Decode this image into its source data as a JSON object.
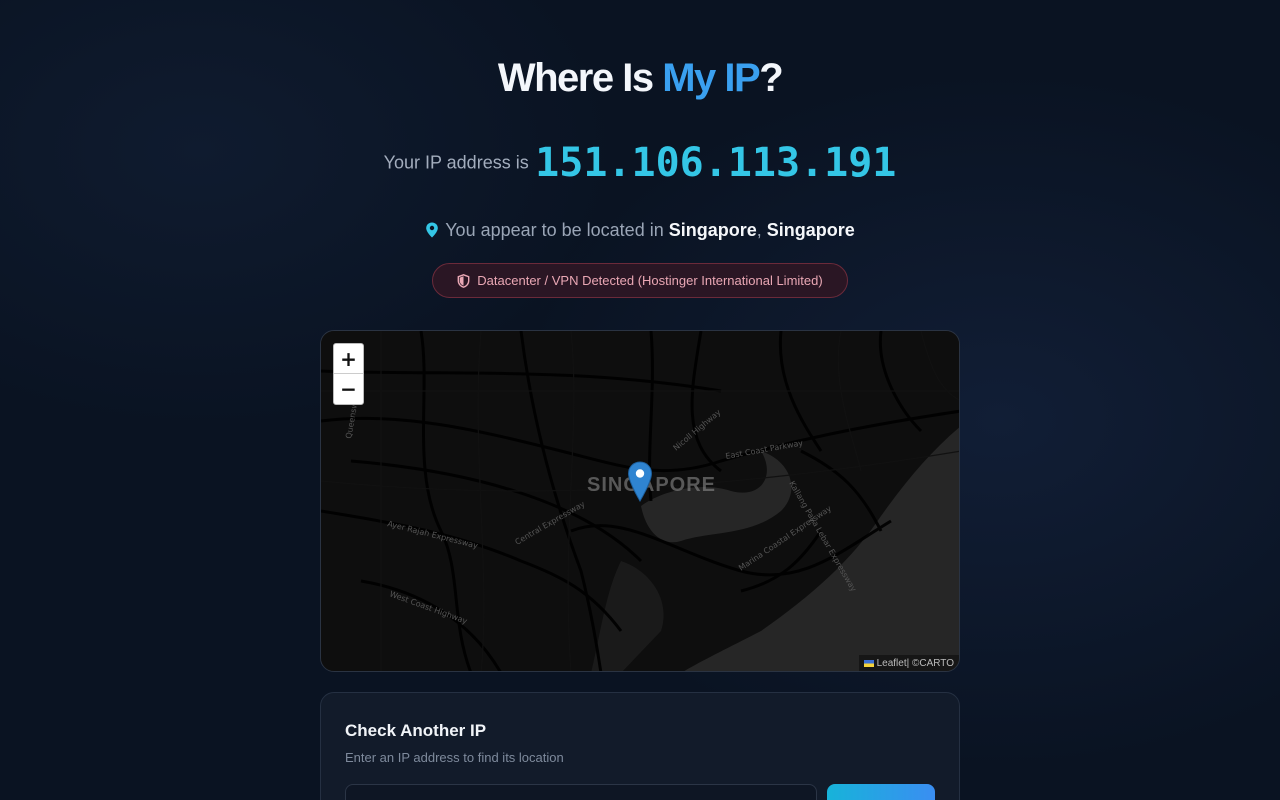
{
  "header": {
    "title_prefix": "Where Is ",
    "title_accent": "My IP",
    "title_suffix": "?"
  },
  "ip": {
    "prefix": "Your IP address is",
    "value": "151.106.113.191"
  },
  "location": {
    "prefix": "You appear to be located in",
    "city": "Singapore",
    "separator": ",",
    "country": "Singapore"
  },
  "badge": {
    "text": "Datacenter / VPN Detected (Hostinger International Limited)"
  },
  "map": {
    "zoom_in": "+",
    "zoom_out": "−",
    "city_label": "SINGAPORE",
    "attribution_leaflet": "Leaflet",
    "attribution_sep": " | © ",
    "attribution_carto": "CARTO",
    "road_labels": [
      "East Coast Parkway",
      "Ayer Rajah Expressway",
      "Central Expressway",
      "West Coast Highway",
      "Marina Coastal Expressway",
      "Nicoll Highway",
      "Queensway",
      "Kallang Paya Lebar Expressway"
    ]
  },
  "lookup": {
    "title": "Check Another IP",
    "subtitle": "Enter an IP address to find its location",
    "input_value": "",
    "button_label": ""
  },
  "colors": {
    "accent": "#3aa0f0",
    "ip": "#34c6e6",
    "badge_text": "#e9a7b4"
  }
}
